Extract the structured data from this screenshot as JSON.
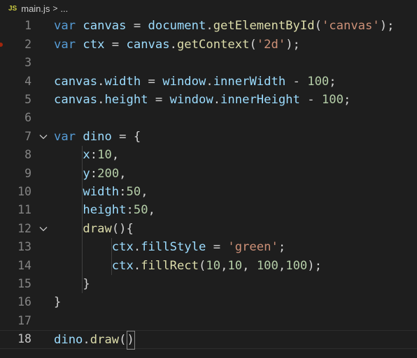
{
  "breadcrumb": {
    "language_badge": "JS",
    "file_name": "main.js",
    "separator": ">",
    "ellipsis": "..."
  },
  "editor": {
    "current_line": 18,
    "line_numbers": [
      "1",
      "2",
      "3",
      "4",
      "5",
      "6",
      "7",
      "8",
      "9",
      "10",
      "11",
      "12",
      "13",
      "14",
      "15",
      "16",
      "17",
      "18"
    ],
    "lines": [
      [
        {
          "t": "var",
          "c": "kw"
        },
        {
          "t": " "
        },
        {
          "t": "canvas",
          "c": "var"
        },
        {
          "t": " = "
        },
        {
          "t": "document",
          "c": "var"
        },
        {
          "t": "."
        },
        {
          "t": "getElementById",
          "c": "fn"
        },
        {
          "t": "("
        },
        {
          "t": "'canvas'",
          "c": "str"
        },
        {
          "t": ");"
        }
      ],
      [
        {
          "t": "var",
          "c": "kw"
        },
        {
          "t": " "
        },
        {
          "t": "ctx",
          "c": "var"
        },
        {
          "t": " = "
        },
        {
          "t": "canvas",
          "c": "var"
        },
        {
          "t": "."
        },
        {
          "t": "getContext",
          "c": "fn"
        },
        {
          "t": "("
        },
        {
          "t": "'2d'",
          "c": "str"
        },
        {
          "t": ");"
        }
      ],
      [],
      [
        {
          "t": "canvas",
          "c": "var"
        },
        {
          "t": "."
        },
        {
          "t": "width",
          "c": "var"
        },
        {
          "t": " = "
        },
        {
          "t": "window",
          "c": "var"
        },
        {
          "t": "."
        },
        {
          "t": "innerWidth",
          "c": "var"
        },
        {
          "t": " - "
        },
        {
          "t": "100",
          "c": "num"
        },
        {
          "t": ";"
        }
      ],
      [
        {
          "t": "canvas",
          "c": "var"
        },
        {
          "t": "."
        },
        {
          "t": "height",
          "c": "var"
        },
        {
          "t": " = "
        },
        {
          "t": "window",
          "c": "var"
        },
        {
          "t": "."
        },
        {
          "t": "innerHeight",
          "c": "var"
        },
        {
          "t": " - "
        },
        {
          "t": "100",
          "c": "num"
        },
        {
          "t": ";"
        }
      ],
      [],
      [
        {
          "t": "var",
          "c": "kw"
        },
        {
          "t": " "
        },
        {
          "t": "dino",
          "c": "var"
        },
        {
          "t": " = {"
        }
      ],
      [
        {
          "t": "    "
        },
        {
          "t": "x",
          "c": "var"
        },
        {
          "t": ":"
        },
        {
          "t": "10",
          "c": "num"
        },
        {
          "t": ","
        }
      ],
      [
        {
          "t": "    "
        },
        {
          "t": "y",
          "c": "var"
        },
        {
          "t": ":"
        },
        {
          "t": "200",
          "c": "num"
        },
        {
          "t": ","
        }
      ],
      [
        {
          "t": "    "
        },
        {
          "t": "width",
          "c": "var"
        },
        {
          "t": ":"
        },
        {
          "t": "50",
          "c": "num"
        },
        {
          "t": ","
        }
      ],
      [
        {
          "t": "    "
        },
        {
          "t": "height",
          "c": "var"
        },
        {
          "t": ":"
        },
        {
          "t": "50",
          "c": "num"
        },
        {
          "t": ","
        }
      ],
      [
        {
          "t": "    "
        },
        {
          "t": "draw",
          "c": "fn"
        },
        {
          "t": "(){"
        }
      ],
      [
        {
          "t": "        "
        },
        {
          "t": "ctx",
          "c": "var"
        },
        {
          "t": "."
        },
        {
          "t": "fillStyle",
          "c": "var"
        },
        {
          "t": " = "
        },
        {
          "t": "'green'",
          "c": "str"
        },
        {
          "t": ";"
        }
      ],
      [
        {
          "t": "        "
        },
        {
          "t": "ctx",
          "c": "var"
        },
        {
          "t": "."
        },
        {
          "t": "fillRect",
          "c": "fn"
        },
        {
          "t": "("
        },
        {
          "t": "10",
          "c": "num"
        },
        {
          "t": ","
        },
        {
          "t": "10",
          "c": "num"
        },
        {
          "t": ", "
        },
        {
          "t": "100",
          "c": "num"
        },
        {
          "t": ","
        },
        {
          "t": "100",
          "c": "num"
        },
        {
          "t": ");"
        }
      ],
      [
        {
          "t": "    }"
        }
      ],
      [
        {
          "t": "}"
        }
      ],
      [],
      [
        {
          "t": "dino",
          "c": "var"
        },
        {
          "t": "."
        },
        {
          "t": "draw",
          "c": "fn"
        },
        {
          "t": "("
        },
        {
          "t": ")",
          "cursor": true
        }
      ]
    ],
    "folded_lines": [
      7,
      12
    ],
    "breakpoint_lines": [
      2
    ]
  },
  "colors": {
    "background": "#1e1e1e",
    "keyword": "#569cd6",
    "variable": "#9cdcfe",
    "function": "#dcdcaa",
    "string": "#ce9178",
    "number": "#b5cea8",
    "text": "#d4d4d4",
    "line_number": "#858585"
  },
  "icons": {
    "fold": "chevron-down-icon",
    "breakpoint": "breakpoint-dot-icon"
  }
}
